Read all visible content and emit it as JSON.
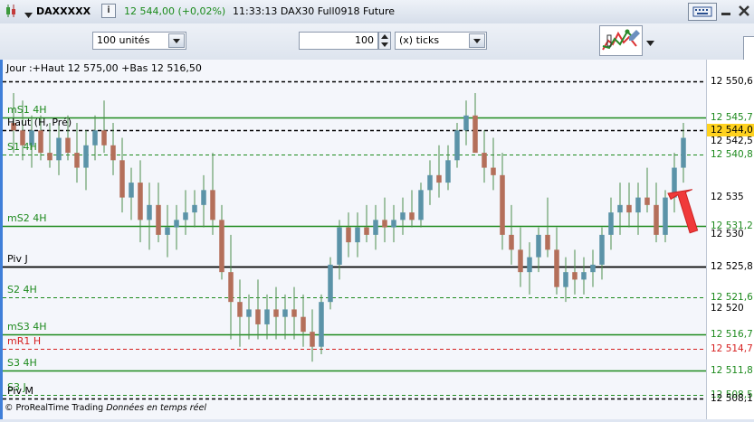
{
  "header": {
    "instrument": "DAXXXXX",
    "info_icon": "i",
    "price_change": "12 544,00 (+0,02%)",
    "time_instrument": "11:33:13 DAX30 Full0918 Future"
  },
  "toolbar": {
    "units_value": "100 unités",
    "ticks_value": "100",
    "ticks_unit": "(x) ticks"
  },
  "chart": {
    "info_line": "Jour :+Haut 12 575,00 +Bas 12 516,50",
    "footer_brand": "© ProRealTime Trading",
    "footer_data": "Données en temps réel",
    "levels": [
      {
        "label": "Haut (H, Pré)",
        "price": 12544.0,
        "axis_text": "12 544,0",
        "color": "#000000",
        "style": "dash-dark",
        "axis_bg": "#ffd21e"
      },
      {
        "label": "mS1 4H",
        "price": 12545.7,
        "axis_text": "12 545,7",
        "color": "#1d8a1d",
        "style": "solid",
        "axis_bg": ""
      },
      {
        "label": "S1 4H",
        "price": 12540.8,
        "axis_text": "12 540,8",
        "color": "#1d8a1d",
        "style": "dash",
        "axis_bg": ""
      },
      {
        "label": "mS2 4H",
        "price": 12531.2,
        "axis_text": "12 531,2",
        "color": "#1d8a1d",
        "style": "solid",
        "axis_bg": ""
      },
      {
        "label": "Piv J",
        "price": 12525.8,
        "axis_text": "12 525,8",
        "color": "#000000",
        "style": "solid",
        "axis_bg": ""
      },
      {
        "label": "S2 4H",
        "price": 12521.6,
        "axis_text": "12 521,6",
        "color": "#1d8a1d",
        "style": "dash",
        "axis_bg": ""
      },
      {
        "label": "mS3 4H",
        "price": 12516.7,
        "axis_text": "12 516,7",
        "color": "#1d8a1d",
        "style": "solid",
        "axis_bg": ""
      },
      {
        "label": "mR1 H",
        "price": 12514.7,
        "axis_text": "12 514,7",
        "color": "#d62020",
        "style": "dash",
        "axis_bg": ""
      },
      {
        "label": "S3 4H",
        "price": 12511.8,
        "axis_text": "12 511,8",
        "color": "#1d8a1d",
        "style": "solid",
        "axis_bg": ""
      },
      {
        "label": "S3 J",
        "price": 12508.5,
        "axis_text": "12 508,5",
        "color": "#1d8a1d",
        "style": "dash",
        "axis_bg": ""
      },
      {
        "label": "Piv M",
        "price": 12508.1,
        "axis_text": "12 508,1",
        "color": "#000000",
        "style": "dash-dark",
        "axis_bg": ""
      },
      {
        "label": "",
        "price": 12550.6,
        "axis_text": "12 550,6",
        "color": "#000000",
        "style": "dash-dark",
        "axis_bg": ""
      }
    ],
    "axis_ticks": [
      "12 542,5",
      "12 535",
      "12 530",
      "12 520"
    ]
  },
  "chart_data": {
    "type": "candlestick",
    "ylim": [
      12506.0,
      12553.0
    ],
    "up_color": "#5b93a8",
    "down_color": "#b46f5a",
    "wick_color": "#4d8e4d",
    "candles": [
      [
        12545,
        12549,
        12541,
        12544
      ],
      [
        12544,
        12548,
        12540,
        12542
      ],
      [
        12542,
        12546,
        12539,
        12544
      ],
      [
        12544,
        12546,
        12540,
        12541
      ],
      [
        12541,
        12545,
        12539,
        12540
      ],
      [
        12540,
        12545,
        12538,
        12543
      ],
      [
        12543,
        12546,
        12540,
        12541
      ],
      [
        12541,
        12545,
        12537,
        12539
      ],
      [
        12539,
        12544,
        12536,
        12542
      ],
      [
        12542,
        12546,
        12540,
        12544
      ],
      [
        12544,
        12548,
        12541,
        12542
      ],
      [
        12542,
        12545,
        12538,
        12540
      ],
      [
        12540,
        12543,
        12533,
        12535
      ],
      [
        12535,
        12539,
        12532,
        12537
      ],
      [
        12537,
        12540,
        12529,
        12532
      ],
      [
        12532,
        12537,
        12528,
        12534
      ],
      [
        12534,
        12537,
        12529,
        12530
      ],
      [
        12530,
        12534,
        12527,
        12531
      ],
      [
        12531,
        12534,
        12528,
        12532
      ],
      [
        12532,
        12536,
        12530,
        12533
      ],
      [
        12533,
        12536,
        12531,
        12534
      ],
      [
        12534,
        12538,
        12531,
        12536
      ],
      [
        12536,
        12541,
        12530,
        12532
      ],
      [
        12532,
        12534,
        12524,
        12525
      ],
      [
        12525,
        12530,
        12516,
        12521
      ],
      [
        12521,
        12524,
        12515,
        12519
      ],
      [
        12519,
        12522,
        12516,
        12520
      ],
      [
        12520,
        12524,
        12516,
        12518
      ],
      [
        12518,
        12522,
        12516,
        12520
      ],
      [
        12520,
        12523,
        12516,
        12519
      ],
      [
        12519,
        12522,
        12516,
        12520
      ],
      [
        12520,
        12523,
        12516,
        12519
      ],
      [
        12519,
        12522,
        12515,
        12517
      ],
      [
        12517,
        12520,
        12513,
        12515
      ],
      [
        12515,
        12522,
        12514,
        12521
      ],
      [
        12521,
        12527,
        12520,
        12526
      ],
      [
        12526,
        12532,
        12524,
        12531
      ],
      [
        12531,
        12533,
        12527,
        12529
      ],
      [
        12529,
        12533,
        12527,
        12531
      ],
      [
        12531,
        12534,
        12529,
        12530
      ],
      [
        12530,
        12534,
        12528,
        12532
      ],
      [
        12532,
        12535,
        12529,
        12531
      ],
      [
        12531,
        12534,
        12529,
        12532
      ],
      [
        12532,
        12535,
        12530,
        12533
      ],
      [
        12533,
        12536,
        12531,
        12532
      ],
      [
        12532,
        12537,
        12531,
        12536
      ],
      [
        12536,
        12540,
        12534,
        12538
      ],
      [
        12538,
        12542,
        12535,
        12537
      ],
      [
        12537,
        12542,
        12536,
        12540
      ],
      [
        12540,
        12545,
        12539,
        12544
      ],
      [
        12544,
        12548,
        12542,
        12546
      ],
      [
        12546,
        12549,
        12543,
        12541
      ],
      [
        12541,
        12544,
        12537,
        12539
      ],
      [
        12539,
        12543,
        12536,
        12538
      ],
      [
        12538,
        12541,
        12528,
        12530
      ],
      [
        12530,
        12534,
        12526,
        12528
      ],
      [
        12528,
        12531,
        12523,
        12525
      ],
      [
        12525,
        12529,
        12522,
        12527
      ],
      [
        12527,
        12531,
        12525,
        12530
      ],
      [
        12530,
        12535,
        12527,
        12528
      ],
      [
        12528,
        12531,
        12522,
        12523
      ],
      [
        12523,
        12527,
        12521,
        12525
      ],
      [
        12525,
        12528,
        12522,
        12524
      ],
      [
        12524,
        12527,
        12522,
        12525
      ],
      [
        12525,
        12528,
        12523,
        12526
      ],
      [
        12526,
        12531,
        12524,
        12530
      ],
      [
        12530,
        12535,
        12528,
        12533
      ],
      [
        12533,
        12537,
        12530,
        12534
      ],
      [
        12534,
        12537,
        12531,
        12533
      ],
      [
        12533,
        12537,
        12530,
        12535
      ],
      [
        12535,
        12539,
        12533,
        12534
      ],
      [
        12534,
        12537,
        12529,
        12530
      ],
      [
        12530,
        12536,
        12529,
        12535
      ],
      [
        12535,
        12541,
        12533,
        12539
      ],
      [
        12539,
        12545,
        12537,
        12543
      ]
    ]
  }
}
